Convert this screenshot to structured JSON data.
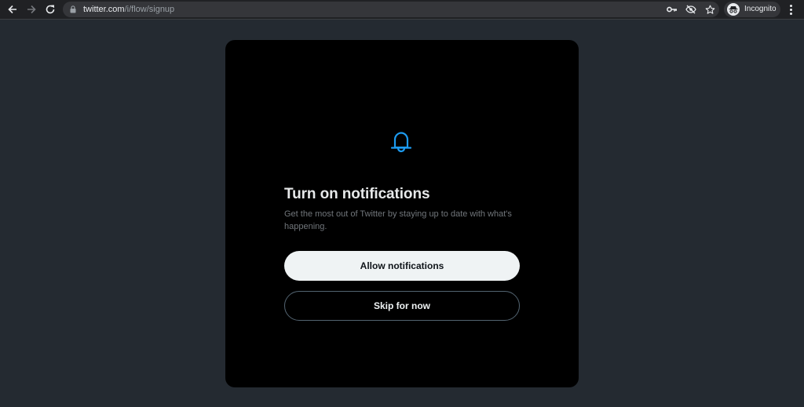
{
  "browser": {
    "url_host": "twitter.com",
    "url_path": "/i/flow/signup",
    "profile_label": "Incognito",
    "icons": [
      "back-icon",
      "forward-icon",
      "reload-icon",
      "lock-icon",
      "key-icon",
      "eye-off-icon",
      "star-icon",
      "incognito-icon",
      "more-icon"
    ]
  },
  "modal": {
    "icon": "bell-icon",
    "accent_color": "#1d9bf0",
    "title": "Turn on notifications",
    "subtitle": "Get the most out of Twitter by staying up to date with what's happening.",
    "primary_button": "Allow notifications",
    "secondary_button": "Skip for now"
  }
}
